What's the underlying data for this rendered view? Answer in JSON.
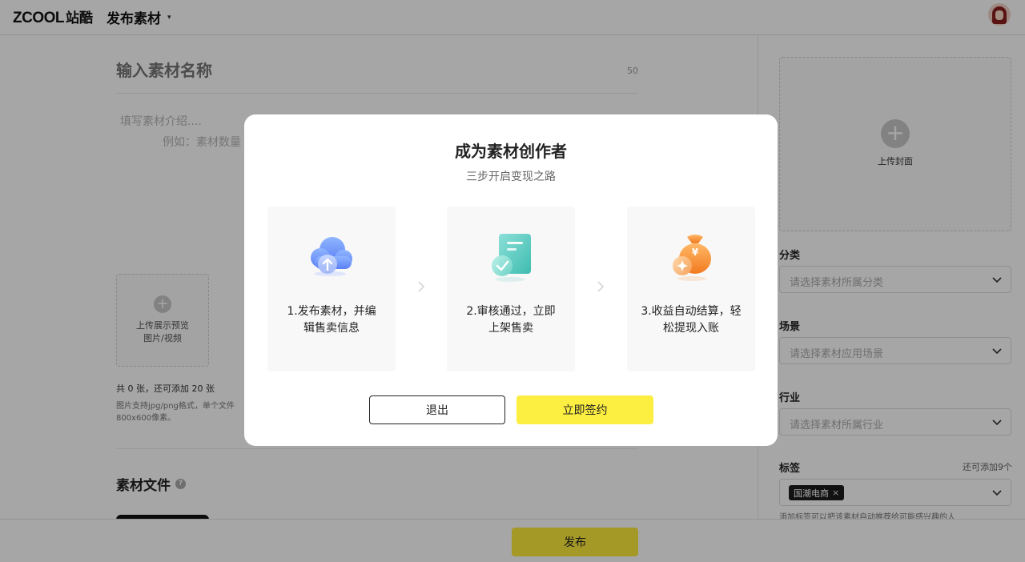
{
  "header": {
    "logo_text": "ZCOOL",
    "logo_cn": "站酷",
    "page_title": "发布素材",
    "caret": "▾"
  },
  "form": {
    "title_placeholder": "输入素材名称",
    "title_max": "50",
    "intro_line1": "填写素材介绍....",
    "intro_line2": "例如：素材数量",
    "preview_plus": "+",
    "preview_label1": "上传展示预览",
    "preview_label2": "图片/视频",
    "preview_count": "共 0 张，还可添加 20 张",
    "preview_hint_line1": "图片支持jpg/png格式，单个文件",
    "preview_hint_line2": "800x600像素。",
    "files_title": "素材文件",
    "files_help": "?"
  },
  "sidebar": {
    "cover_plus": "+",
    "cover_label": "上传封面",
    "category_label": "分类",
    "category_placeholder": "请选择素材所属分类",
    "scene_label": "场景",
    "scene_placeholder": "请选择素材应用场景",
    "industry_label": "行业",
    "industry_placeholder": "请选择素材所属行业",
    "tags_label": "标签",
    "tags_more": "还可添加9个",
    "tag_chip": "国潮电商",
    "tag_remove": "×",
    "tags_hint": "添加标签可以把该素材自动推荐给可能感兴趣的人"
  },
  "bottom": {
    "publish_label": "发布"
  },
  "modal": {
    "title": "成为素材创作者",
    "subtitle": "三步开启变现之路",
    "steps": [
      {
        "line1": "1.发布素材，并编",
        "line2": "辑售卖信息",
        "icon": "cloud-upload-icon"
      },
      {
        "line1": "2.审核通过，立即",
        "line2": "上架售卖",
        "icon": "document-check-icon"
      },
      {
        "line1": "3.收益自动结算，轻",
        "line2": "松提现入账",
        "icon": "money-bag-icon"
      }
    ],
    "exit_label": "退出",
    "sign_label": "立即签约"
  },
  "colors": {
    "accent_yellow": "#fdee42",
    "overlay": "rgba(0,0,0,0.35)"
  }
}
